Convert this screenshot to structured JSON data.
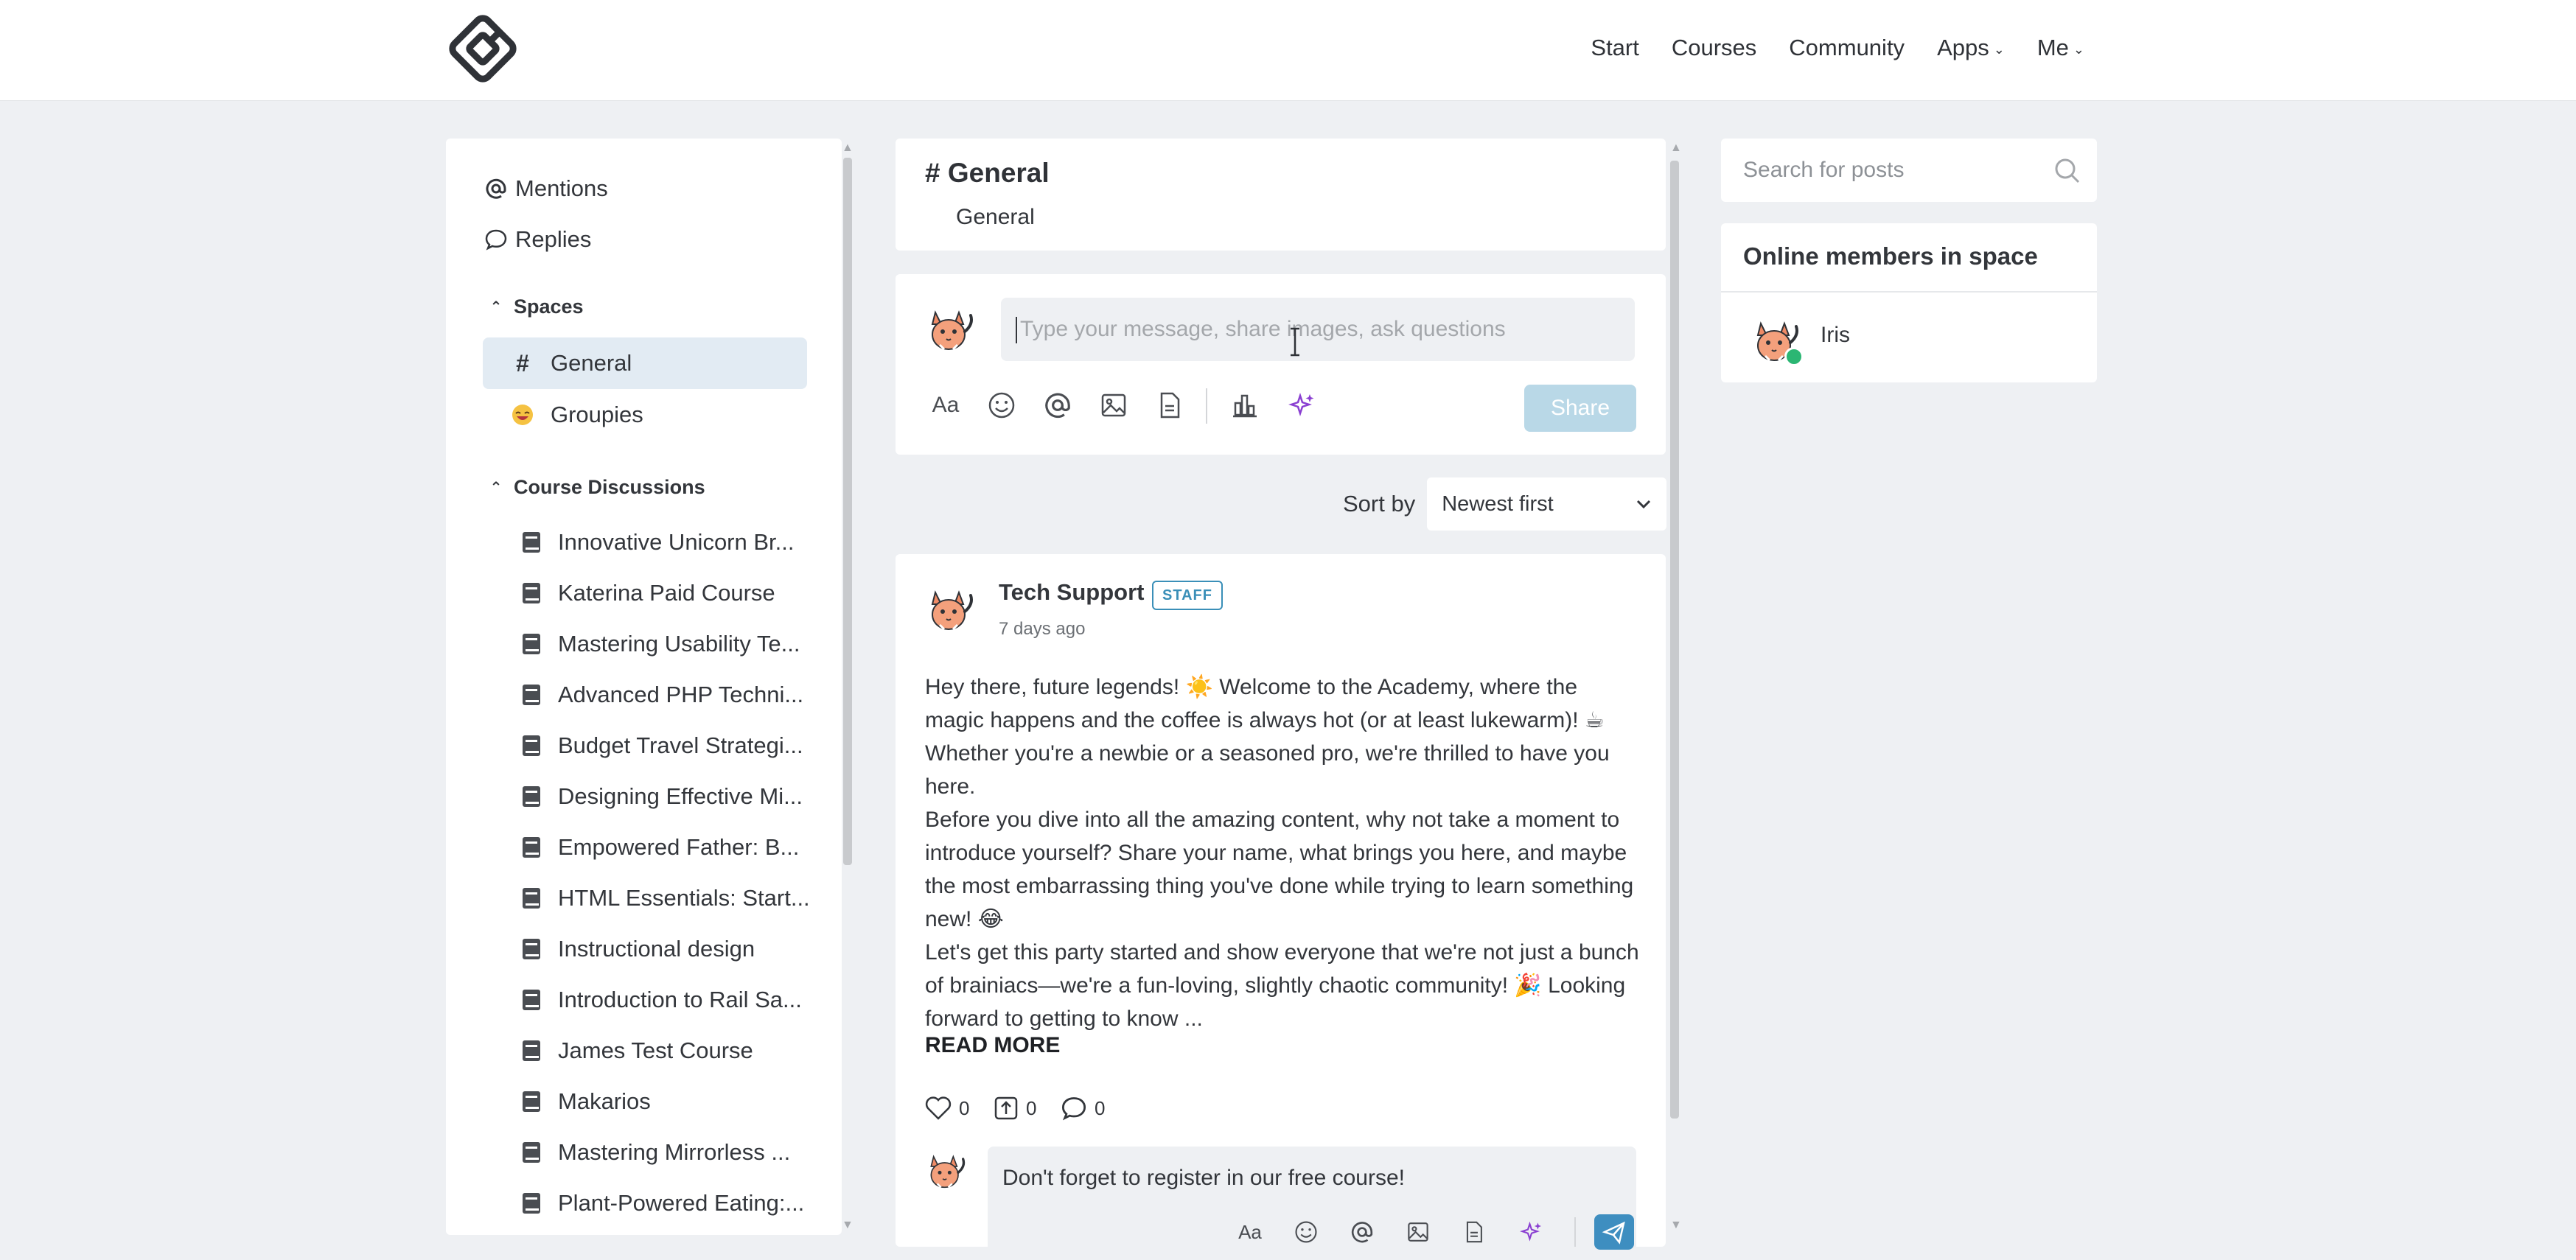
{
  "nav": {
    "logo": "logo-icon",
    "items": [
      {
        "label": "Start",
        "dropdown": false
      },
      {
        "label": "Courses",
        "dropdown": false
      },
      {
        "label": "Community",
        "dropdown": false
      },
      {
        "label": "Apps",
        "dropdown": true
      },
      {
        "label": "Me",
        "dropdown": true
      }
    ]
  },
  "sidebar": {
    "mentions": "Mentions",
    "replies": "Replies",
    "spaces_heading": "Spaces",
    "spaces": [
      {
        "label": "General",
        "icon": "hash-icon",
        "active": true
      },
      {
        "label": "Groupies",
        "icon": "emoji-icon",
        "active": false
      }
    ],
    "courses_heading": "Course Discussions",
    "courses": [
      "Innovative Unicorn Br...",
      "Katerina Paid Course",
      "Mastering Usability Te...",
      "Advanced PHP Techni...",
      "Budget Travel Strategi...",
      "Designing Effective Mi...",
      "Empowered Father: B...",
      "HTML Essentials: Start...",
      "Instructional design",
      "Introduction to Rail Sa...",
      "James Test Course",
      "Makarios",
      "Mastering Mirrorless ...",
      "Plant-Powered Eating:..."
    ]
  },
  "channel": {
    "title": "# General",
    "subtitle": "General"
  },
  "composer": {
    "placeholder": "Type your message, share images, ask questions",
    "share_label": "Share"
  },
  "sort": {
    "label": "Sort by",
    "selected": "Newest first"
  },
  "post": {
    "author": "Tech Support",
    "badge": "STAFF",
    "time": "7 days ago",
    "paragraphs": [
      "Hey there, future legends! ☀️ Welcome to the Academy, where the magic happens and the coffee is always hot (or at least lukewarm)! ☕ Whether you're a newbie or a seasoned pro, we're thrilled to have you here.",
      "Before you dive into all the amazing content, why not take a moment to introduce yourself? Share your name, what brings you here, and maybe the most embarrassing thing you've done while trying to learn something new! 😂",
      "Let's get this party started and show everyone that we're not just a bunch of brainiacs—we're a fun-loving, slightly chaotic community! 🎉 Looking forward to getting to know ..."
    ],
    "read_more": "READ MORE",
    "likes": "0",
    "shares": "0",
    "comments": "0",
    "reply_text": "Don't forget to register in our free course!"
  },
  "right": {
    "search_placeholder": "Search for posts",
    "members_title": "Online members in space",
    "members": [
      {
        "name": "Iris",
        "online": true
      }
    ]
  },
  "colors": {
    "accent": "#3e8ec0",
    "share_disabled": "#b9d8e7",
    "active_space": "#e2ebf3",
    "ai_icon": "#8a3fd1",
    "online": "#2bb673",
    "background": "#eef0f3"
  }
}
